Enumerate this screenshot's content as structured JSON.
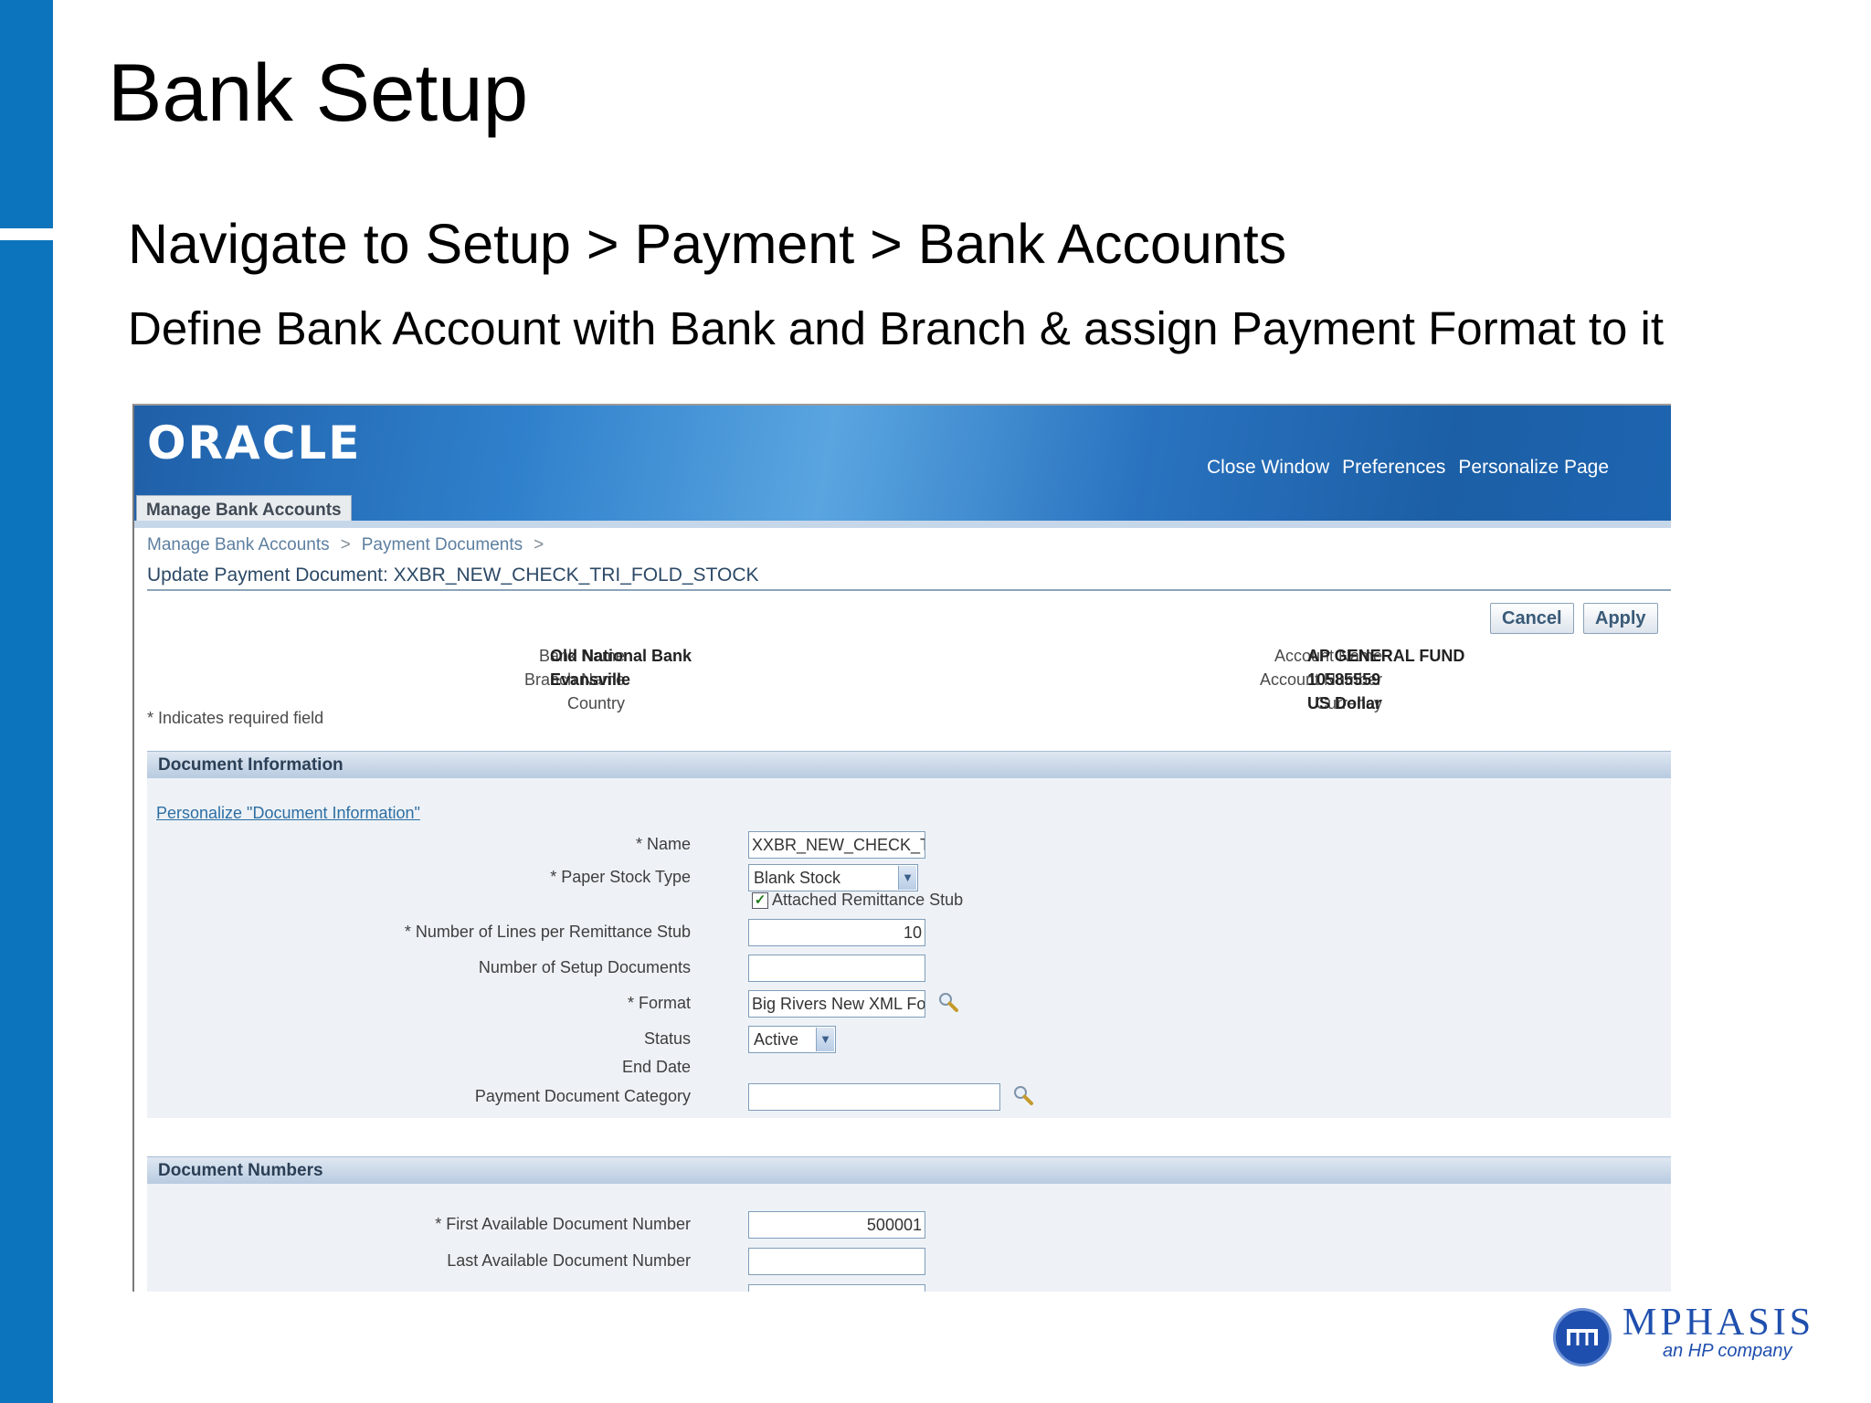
{
  "slide": {
    "title": "Bank Setup",
    "bullet_1": "Navigate to Setup > Payment > Bank Accounts",
    "bullet_2": "Define Bank Account with Bank and Branch & assign Payment Format to it"
  },
  "app": {
    "logo": "ORACLE",
    "global_links": [
      "Close Window",
      "Preferences",
      "Personalize Page"
    ],
    "tab": "Manage Bank Accounts",
    "breadcrumbs": [
      "Manage Bank Accounts",
      "Payment Documents"
    ],
    "breadcrumb_separator": ">",
    "page_heading": "Update Payment Document: XXBR_NEW_CHECK_TRI_FOLD_STOCK",
    "buttons": {
      "cancel": "Cancel",
      "apply": "Apply"
    },
    "bank_info": {
      "bank_name_label": "Bank Name",
      "bank_name": "Old National Bank",
      "branch_name_label": "Branch Name",
      "branch_name": "Evansville",
      "country_label": "Country",
      "country": ""
    },
    "account_info": {
      "account_name_label": "Account Name",
      "account_name": "AP GENERAL FUND",
      "account_number_label": "Account Number",
      "account_number": "10585559",
      "currency_label": "Currency",
      "currency": "US Dollar"
    },
    "required_note": "* Indicates required field",
    "document_information": {
      "section_title": "Document Information",
      "personalize_link": "Personalize \"Document Information\"",
      "name_label": "* Name",
      "name_value": "XXBR_NEW_CHECK_TRI_",
      "paper_stock_label": "* Paper Stock Type",
      "paper_stock_value": "Blank Stock",
      "remittance_stub_label": "Attached Remittance Stub",
      "remittance_stub_checked": true,
      "lines_label": "* Number of Lines per Remittance Stub",
      "lines_value": "10",
      "setup_docs_label": "Number of Setup Documents",
      "setup_docs_value": "",
      "format_label": "* Format",
      "format_value": "Big Rivers New XML Forr",
      "status_label": "Status",
      "status_value": "Active",
      "end_date_label": "End Date",
      "category_label": "Payment Document Category",
      "category_value": ""
    },
    "document_numbers": {
      "section_title": "Document Numbers",
      "first_label": "* First Available Document Number",
      "first_value": "500001",
      "last_label": "Last Available Document Number",
      "last_value": ""
    }
  },
  "branding": {
    "company": "MPHASIS",
    "tagline": "an HP company",
    "accent": "#0b74bc"
  }
}
